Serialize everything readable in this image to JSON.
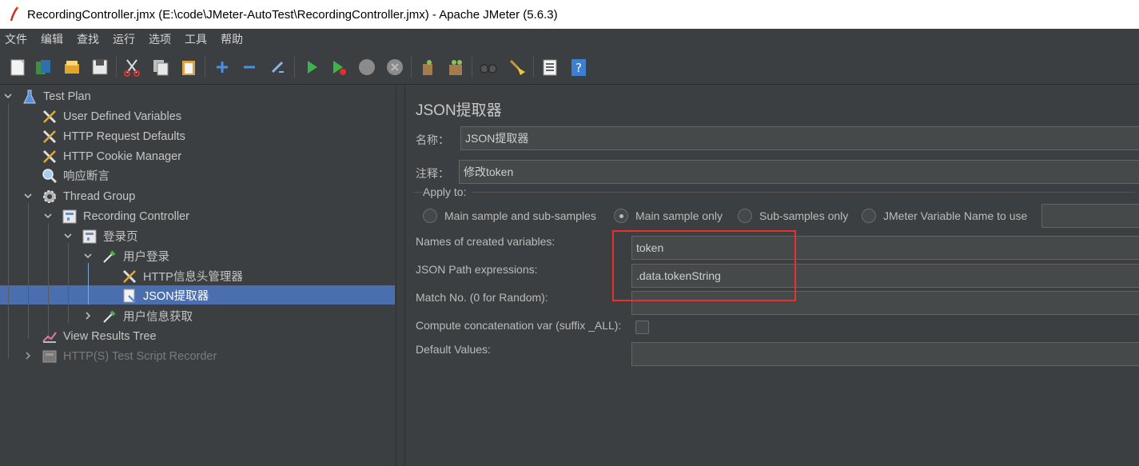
{
  "window": {
    "title": "RecordingController.jmx (E:\\code\\JMeter-AutoTest\\RecordingController.jmx) - Apache JMeter (5.6.3)"
  },
  "menu": [
    "文件",
    "编辑",
    "查找",
    "运行",
    "选项",
    "工具",
    "帮助"
  ],
  "toolbar": {
    "buttons": [
      "new-icon",
      "templates-icon",
      "open-icon",
      "save-icon",
      "cut-icon",
      "copy-icon",
      "paste-icon",
      "expand-icon",
      "collapse-icon",
      "toggle-icon",
      "start-icon",
      "start-no-pause-icon",
      "stop-icon",
      "shutdown-icon",
      "clear-icon",
      "clear-all-icon",
      "search-icon",
      "reset-search-icon",
      "function-helper-icon",
      "help-icon"
    ]
  },
  "tree": {
    "items": [
      {
        "label": "Test Plan"
      },
      {
        "label": "User Defined Variables"
      },
      {
        "label": "HTTP Request Defaults"
      },
      {
        "label": "HTTP Cookie Manager"
      },
      {
        "label": "响应断言"
      },
      {
        "label": "Thread Group"
      },
      {
        "label": "Recording Controller"
      },
      {
        "label": "登录页"
      },
      {
        "label": "用户登录"
      },
      {
        "label": "HTTP信息头管理器"
      },
      {
        "label": "JSON提取器"
      },
      {
        "label": "用户信息获取"
      },
      {
        "label": "View Results Tree"
      },
      {
        "label": "HTTP(S) Test Script Recorder"
      }
    ]
  },
  "panel": {
    "title": "JSON提取器",
    "name_label": "名称：",
    "name_value": "JSON提取器",
    "comment_label": "注释：",
    "comment_value": "修改token",
    "apply_to_label": "Apply to:",
    "apply_options": [
      "Main sample and sub-samples",
      "Main sample only",
      "Sub-samples only",
      "JMeter Variable Name to use"
    ],
    "apply_selected": "Main sample only",
    "var_names_label": "Names of created variables:",
    "var_names_value": "token",
    "json_path_label": "JSON Path expressions:",
    "json_path_value": ".data.tokenString",
    "match_no_label": "Match No. (0 for Random):",
    "match_no_value": "",
    "concat_label": "Compute concatenation var (suffix _ALL):",
    "default_label": "Default Values:",
    "default_value": ""
  },
  "colors": {
    "background": "#3c3f41",
    "selection": "#4b6eaf",
    "highlight_box": "#e8302d"
  }
}
